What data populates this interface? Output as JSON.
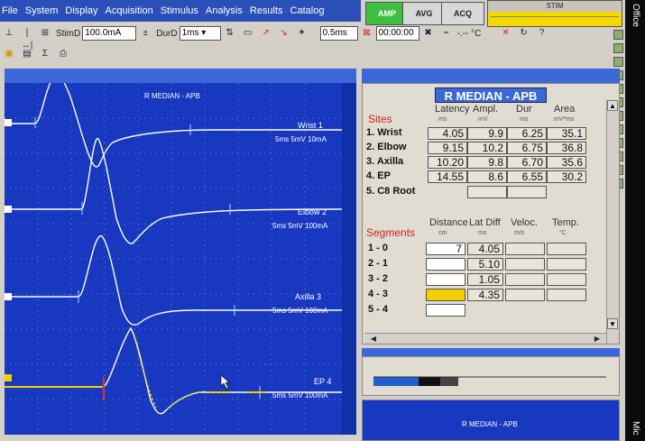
{
  "menu": [
    "File",
    "System",
    "Display",
    "Acquisition",
    "Stimulus",
    "Analysis",
    "Results",
    "Catalog"
  ],
  "top_buttons": {
    "amp": "AMP",
    "avg": "AVG",
    "acq": "ACQ",
    "stim": "STIM"
  },
  "office": {
    "top": "Office",
    "bottom": "Mic"
  },
  "toolbar": {
    "stim_label": "StimD",
    "stim_value": "100.0mA",
    "dur_label": "DurD",
    "dur_value": "1ms",
    "sens_value": "0.5ms",
    "timer_value": "00:00:00",
    "temp_value": "-.-- °C"
  },
  "traces": {
    "title": "R MEDIAN - APB",
    "labels": [
      {
        "name": "Wrist 1",
        "scale": "5ms 5mV 10mA"
      },
      {
        "name": "Elbow 2",
        "scale": "5ms 5mV 100mA"
      },
      {
        "name": "Axilla 3",
        "scale": "5ms 5mV 100mA"
      },
      {
        "name": "EP 4",
        "scale": "5ms 5mV 100mA"
      }
    ]
  },
  "results": {
    "title": "R MEDIAN - APB",
    "sites_label": "Sites",
    "headers": [
      "Latency",
      "Ampl.",
      "Dur",
      "Area"
    ],
    "units": [
      "ms",
      "mV",
      "ms",
      "mV*ms"
    ],
    "sites": [
      {
        "label": "1. Wrist",
        "latency": "4.05",
        "ampl": "9.9",
        "dur": "6.25",
        "area": "35.1"
      },
      {
        "label": "2. Elbow",
        "latency": "9.15",
        "ampl": "10.2",
        "dur": "6.75",
        "area": "36.8"
      },
      {
        "label": "3. Axilla",
        "latency": "10.20",
        "ampl": "9.8",
        "dur": "6.70",
        "area": "35.6"
      },
      {
        "label": "4. EP",
        "latency": "14.55",
        "ampl": "8.6",
        "dur": "6.55",
        "area": "30.2"
      },
      {
        "label": "5. C8 Root",
        "latency": "",
        "ampl": "",
        "dur": "",
        "area": ""
      }
    ],
    "segments_label": "Segments",
    "seg_headers": [
      "Distance",
      "Lat Diff",
      "Veloc.",
      "Temp."
    ],
    "seg_units": [
      "cm",
      "ms",
      "m/s",
      "°C"
    ],
    "segments": [
      {
        "label": "1 - 0",
        "distance": "7",
        "latdiff": "4.05"
      },
      {
        "label": "2 - 1",
        "distance": "",
        "latdiff": "5.10"
      },
      {
        "label": "3 - 2",
        "distance": "",
        "latdiff": "1.05"
      },
      {
        "label": "4 - 3",
        "distance": "",
        "latdiff": "4.35"
      },
      {
        "label": "5 - 4",
        "distance": "",
        "latdiff": ""
      }
    ]
  },
  "bottom": {
    "display_title": "R MEDIAN - APB"
  }
}
